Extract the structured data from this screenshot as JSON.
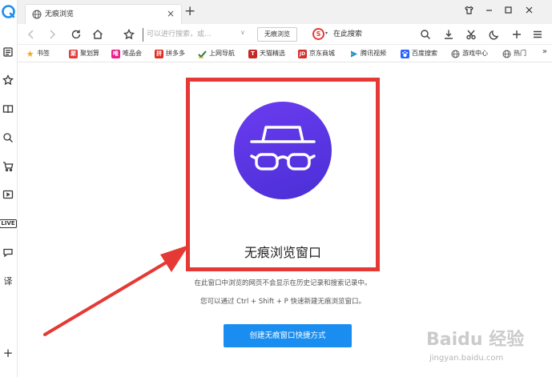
{
  "tab": {
    "title": "无痕浏览",
    "close": "×"
  },
  "new_tab": "+",
  "toolbar": {
    "address_placeholder": "可以进行搜索，或...",
    "address_caret": "∨",
    "incognito_button": "无痕浏览",
    "search_engine_letter": "S",
    "search_caret": "▾",
    "search_placeholder": "在此搜索"
  },
  "bookmarks": [
    {
      "label": "书签",
      "icon": "star-icon",
      "color": "#f5a623"
    },
    {
      "label": "聚划算",
      "icon": "juhuasuan-icon",
      "color": "#e53935"
    },
    {
      "label": "唯品会",
      "icon": "vip-icon",
      "color": "#e91e8c"
    },
    {
      "label": "拼多多",
      "icon": "pinduoduo-icon",
      "color": "#e02e24"
    },
    {
      "label": "上网导航",
      "icon": "nav-icon",
      "color": "#2e7d32"
    },
    {
      "label": "天猫精选",
      "icon": "tmall-icon",
      "color": "#c62828"
    },
    {
      "label": "京东商城",
      "icon": "jd-icon",
      "color": "#d32f2f"
    },
    {
      "label": "腾讯视频",
      "icon": "tencent-video-icon",
      "color": "#1e88e5"
    },
    {
      "label": "百度搜索",
      "icon": "baidu-icon",
      "color": "#2962ff"
    },
    {
      "label": "游戏中心",
      "icon": "game-icon",
      "color": "#555555"
    },
    {
      "label": "热门",
      "icon": "hot-icon",
      "color": "#555555"
    }
  ],
  "bookmarks_more": "»",
  "bookmark_glyphs": {
    "juhuasuan": "聚",
    "vip": "唯",
    "pinduoduo": "拼",
    "tmall": "T",
    "jd": "JD"
  },
  "sidebar": {
    "live_label": "LIVE",
    "translate_label": "译",
    "add": "+"
  },
  "content": {
    "title": "无痕浏览窗口",
    "desc1": "在此窗口中浏览的网页不会显示在历史记录和搜索记录中。",
    "desc2": "您可以通过 Ctrl + Shift + P 快速新建无痕浏览窗口。",
    "create_button": "创建无痕窗口快捷方式"
  },
  "watermark": {
    "main": "Baidu 经验",
    "sub": "jingyan.baidu.com"
  },
  "colors": {
    "accent_blue": "#1a8ef0",
    "incognito_purple": "#5a34e4",
    "annotation_red": "#e53935"
  }
}
